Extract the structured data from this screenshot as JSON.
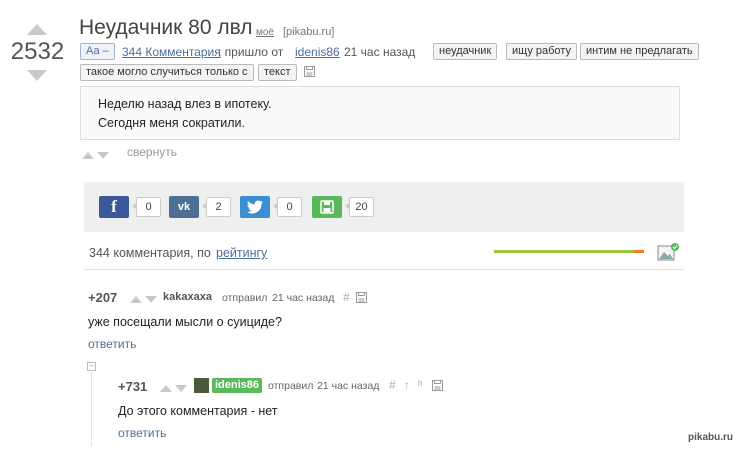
{
  "post": {
    "rating": "2532",
    "title": "Неудачник 80 лвл",
    "mine_link": "моё",
    "source": "[pikabu.ru]",
    "font_toggle": "Аа –",
    "comments_link": "344 Комментария",
    "sent_from": "; пришло от",
    "author": "idenis86",
    "time": "21 час назад",
    "tags": [
      "неудачник",
      "ищу работу",
      "интим не предлагать",
      "такое могло случиться только с",
      "текст"
    ],
    "body_lines": [
      "Неделю назад влез в ипотеку.",
      "Сегодня меня сократили."
    ],
    "collapse": "свернуть"
  },
  "share": {
    "facebook": {
      "icon": "f",
      "count": "0",
      "color": "#3b5998"
    },
    "vk": {
      "icon": "vk",
      "count": "2",
      "color": "#4e6f95"
    },
    "twitter": {
      "icon": "twitter-bird",
      "count": "0",
      "color": "#3a8fd4"
    },
    "save": {
      "icon": "floppy",
      "count": "20",
      "color": "#5cb85c"
    }
  },
  "comments_header": {
    "count_text": "344 комментария, по",
    "sort": "рейтингу"
  },
  "comments": [
    {
      "rating": "+207",
      "user": "kakaxaxa",
      "sent": "отправил",
      "time": "21 час назад",
      "text": "уже посещали мысли о суициде?",
      "reply": "ответить"
    },
    {
      "rating": "+731",
      "user": "idenis86",
      "sent": "отправил",
      "time": "21 час назад",
      "text": "До этого комментария - нет",
      "reply": "ответить"
    }
  ],
  "watermark": "pikabu.ru",
  "colors": {
    "link": "#4a6f9a",
    "green_bar": "#9ac835",
    "orange": "#f07f1b",
    "author_badge": "#5cb85c"
  }
}
